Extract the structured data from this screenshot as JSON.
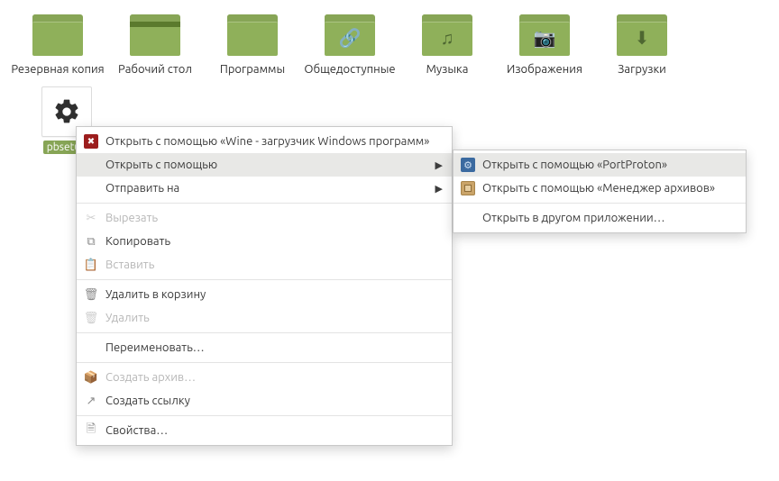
{
  "colors": {
    "folder": "#8fb05a",
    "folder_dark": "#87a556",
    "selection": "#87a556"
  },
  "desktop": {
    "items": [
      {
        "label": "Резервная копия",
        "glyph": ""
      },
      {
        "label": "Рабочий стол",
        "glyph": "",
        "desktop_bar": true
      },
      {
        "label": "Программы",
        "glyph": ""
      },
      {
        "label": "Общедоступные",
        "glyph": "🔗"
      },
      {
        "label": "Музыка",
        "glyph": "♫"
      },
      {
        "label": "Изображения",
        "glyph": "📷"
      },
      {
        "label": "Загрузки",
        "glyph": "⬇"
      }
    ],
    "selected_file": {
      "label": "pbsetup"
    }
  },
  "context_menu": {
    "items": [
      {
        "label": "Открыть с помощью «Wine - загрузчик Windows программ»",
        "icon": "wine"
      },
      {
        "label": "Открыть с помощью",
        "submenu": true,
        "hover": true,
        "indent": true
      },
      {
        "label": "Отправить на",
        "submenu": true,
        "indent": true
      },
      {
        "sep": true
      },
      {
        "label": "Вырезать",
        "icon": "cut",
        "disabled": true
      },
      {
        "label": "Копировать",
        "icon": "copy"
      },
      {
        "label": "Вставить",
        "icon": "paste",
        "disabled": true
      },
      {
        "sep": true
      },
      {
        "label": "Удалить в корзину",
        "icon": "trash"
      },
      {
        "label": "Удалить",
        "icon": "delete",
        "disabled": true
      },
      {
        "sep": true
      },
      {
        "label": "Переименовать…",
        "indent": true
      },
      {
        "sep": true
      },
      {
        "label": "Создать архив…",
        "icon": "archive",
        "disabled": true
      },
      {
        "label": "Создать ссылку",
        "icon": "link"
      },
      {
        "sep": true
      },
      {
        "label": "Свойства…",
        "icon": "props"
      }
    ]
  },
  "submenu": {
    "items": [
      {
        "label": "Открыть с помощью «PortProton»",
        "icon": "port",
        "hover": true
      },
      {
        "label": "Открыть с помощью «Менеджер архивов»",
        "icon": "arch"
      },
      {
        "sep": true
      },
      {
        "label": "Открыть в другом приложении…",
        "indent": true
      }
    ]
  }
}
